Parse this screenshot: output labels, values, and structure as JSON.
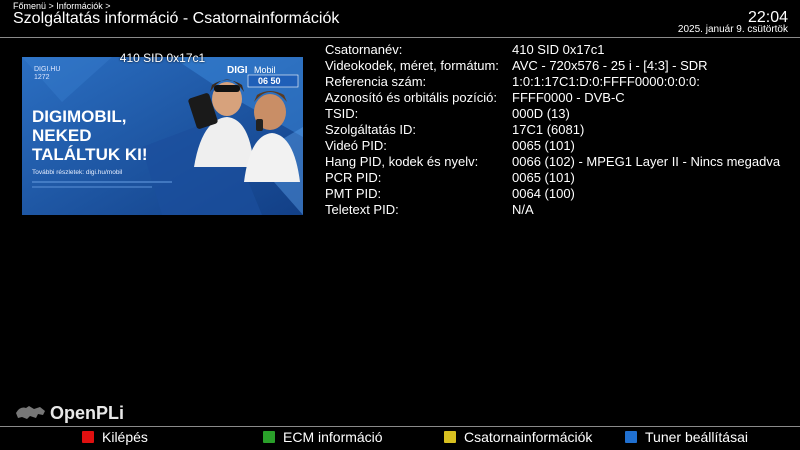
{
  "header": {
    "breadcrumb": "Főmenü > Információk >",
    "title": "Szolgáltatás információ - Csatornainformációk",
    "time": "22:04",
    "date": "2025. január  9. csütörtök"
  },
  "preview": {
    "label": "410 SID 0x17c1",
    "brand": "DIGI.HU",
    "channel_num": "1272",
    "logo": "DIGI",
    "logo_sub": "Mobil",
    "number": "06 50",
    "headline": [
      "DIGIMOBIL,",
      "NEKED",
      "TALÁLTUK KI!"
    ],
    "footer": "További részletek: digi.hu/mobil"
  },
  "info": [
    {
      "key": "Csatornanév:",
      "value": "410 SID 0x17c1"
    },
    {
      "key": "Videokodek, méret, formátum:",
      "value": "AVC - 720x576 - 25 i - [4:3] - SDR"
    },
    {
      "key": "Referencia szám:",
      "value": "1:0:1:17C1:D:0:FFFF0000:0:0:0:"
    },
    {
      "key": "Azonosító és orbitális pozíció:",
      "value": "FFFF0000 - DVB-C"
    },
    {
      "key": "TSID:",
      "value": "000D (13)"
    },
    {
      "key": "Szolgáltatás ID:",
      "value": "17C1 (6081)"
    },
    {
      "key": "Videó PID:",
      "value": "0065 (101)"
    },
    {
      "key": "Hang PID, kodek és nyelv:",
      "value": "0066 (102) - MPEG1 Layer II - Nincs megadva"
    },
    {
      "key": "PCR PID:",
      "value": "0065 (101)"
    },
    {
      "key": "PMT PID:",
      "value": "0064 (100)"
    },
    {
      "key": "Teletext PID:",
      "value": "N/A"
    }
  ],
  "footer": {
    "logo_text": "OpenPLi",
    "buttons": [
      {
        "label": "Kilépés",
        "color": "#e01010"
      },
      {
        "label": "ECM információ",
        "color": "#2aa02a"
      },
      {
        "label": "Csatornainformációk",
        "color": "#d8c020"
      },
      {
        "label": "Tuner beállításai",
        "color": "#2070d0"
      }
    ]
  }
}
